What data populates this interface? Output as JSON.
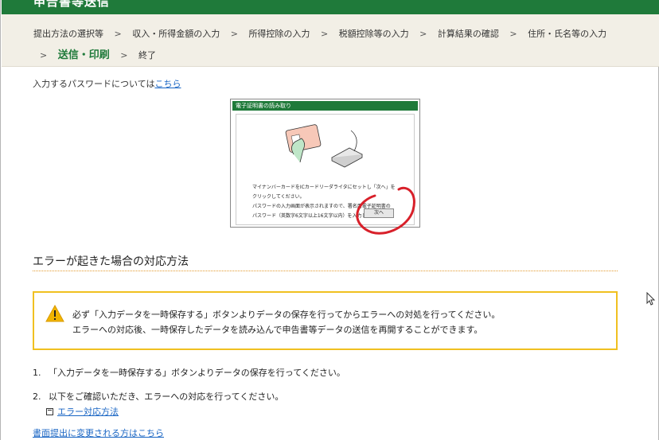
{
  "header": {
    "title": "申告書等送信"
  },
  "breadcrumb": {
    "items": [
      "提出方法の選択等",
      "収入・所得金額の入力",
      "所得控除の入力",
      "税額控除等の入力",
      "計算結果の確認",
      "住所・氏名等の入力"
    ],
    "current": "送信・印刷",
    "last": "終了",
    "separator": ">"
  },
  "password_note": {
    "text": "入力するパスワードについては",
    "link": "こちら"
  },
  "dialog": {
    "title": "電子証明書の読み取り",
    "lines": [
      "マイナンバーカードをICカードリーダライタにセットし「次へ」を",
      "クリックしてください。",
      "パスワードの入力画面が表示されますので、署名用電子証明書の",
      "パスワード（英数字6文字以上16文字以内）を入力してください。"
    ],
    "next_button": "次へ"
  },
  "error_section": {
    "title": "エラーが起きた場合の対応方法"
  },
  "warning": {
    "line1": "必ず「入力データを一時保存する」ボタンよりデータの保存を行ってからエラーへの対処を行ってください。",
    "line2": "エラーへの対応後、一時保存したデータを読み込んで申告書等データの送信を再開することができます。"
  },
  "steps": [
    {
      "num": "1.",
      "text": "「入力データを一時保存する」ボタンよりデータの保存を行ってください。"
    },
    {
      "num": "2.",
      "text": "以下をご確認いただき、エラーへの対応を行ってください。"
    }
  ],
  "error_link": "エラー対応方法",
  "paper_link": "書面提出に変更される方はこちら",
  "colors": {
    "green": "#1f7a3a",
    "accent_orange": "#e39a2e",
    "warning_border": "#f0c020",
    "link": "#1a66c4",
    "annotation_red": "#d8202a"
  }
}
